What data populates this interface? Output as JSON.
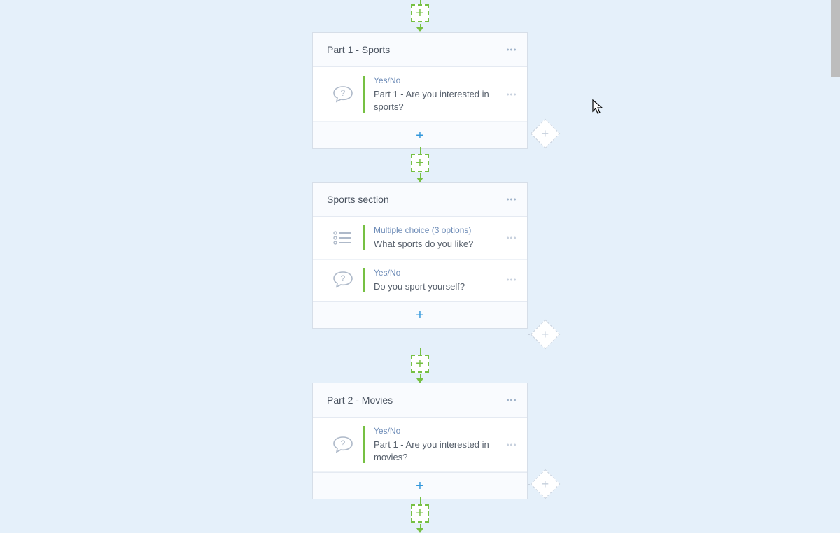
{
  "blocks": [
    {
      "title": "Part 1 - Sports",
      "questions": [
        {
          "type": "Yes/No",
          "text": "Part 1 - Are you interested in sports?",
          "icon": "yesno"
        }
      ]
    },
    {
      "title": "Sports section",
      "questions": [
        {
          "type": "Multiple choice (3 options)",
          "text": "What sports do you like?",
          "icon": "mc"
        },
        {
          "type": "Yes/No",
          "text": "Do you sport yourself?",
          "icon": "yesno"
        }
      ]
    },
    {
      "title": "Part 2 - Movies",
      "questions": [
        {
          "type": "Yes/No",
          "text": "Part 1 - Are you interested in movies?",
          "icon": "yesno"
        }
      ]
    }
  ]
}
